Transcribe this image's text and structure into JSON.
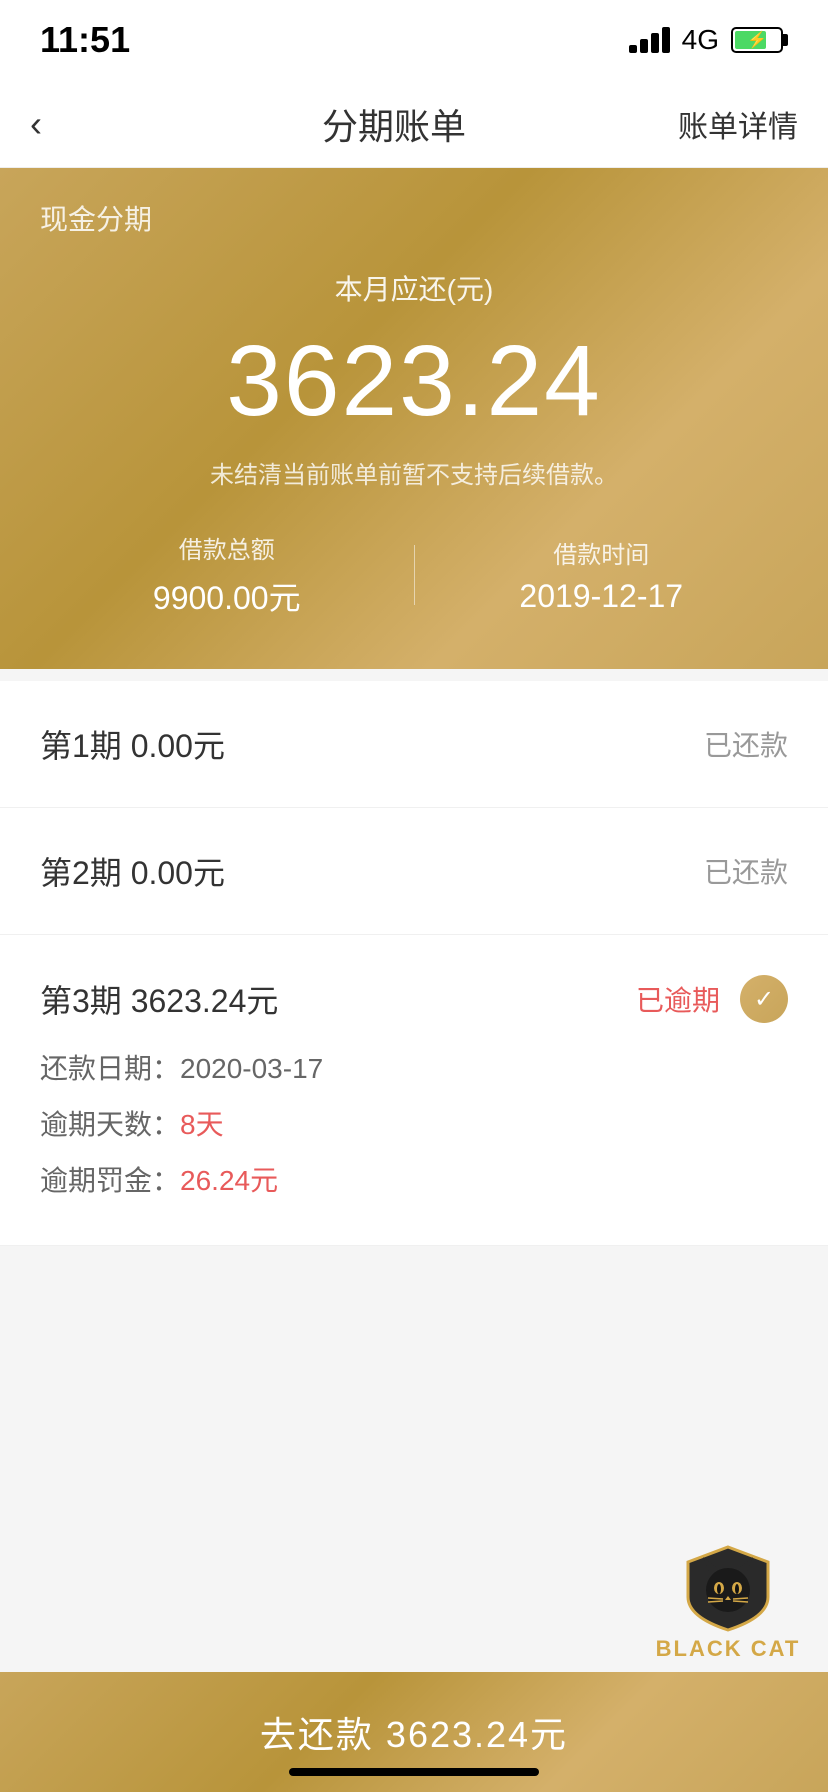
{
  "statusBar": {
    "time": "11:51",
    "signal": "4G"
  },
  "navBar": {
    "backLabel": "‹",
    "title": "分期账单",
    "actionLabel": "账单详情"
  },
  "headerCard": {
    "sectionLabel": "现金分期",
    "amountLabel": "本月应还(元)",
    "amount": "3623.24",
    "notice": "未结清当前账单前暂不支持后续借款。",
    "loanTotal": {
      "label": "借款总额",
      "value": "9900.00元"
    },
    "loanDate": {
      "label": "借款时间",
      "value": "2019-12-17"
    }
  },
  "installments": [
    {
      "period": "第1期  0.00元",
      "status": "已还款",
      "type": "paid"
    },
    {
      "period": "第2期  0.00元",
      "status": "已还款",
      "type": "paid"
    },
    {
      "period": "第3期  3623.24元",
      "status": "已逾期",
      "type": "overdue",
      "detail": {
        "repayDate": "还款日期：2020-03-17",
        "overdueDaysLabel": "逾期天数：",
        "overdueDays": "8天",
        "overdueFineLabel": "逾期罚金：",
        "overdueFine": "26.24元"
      }
    }
  ],
  "bottomBar": {
    "label": "去还款  3623.24元"
  },
  "blackCat": {
    "text": "BLACK CAT"
  }
}
